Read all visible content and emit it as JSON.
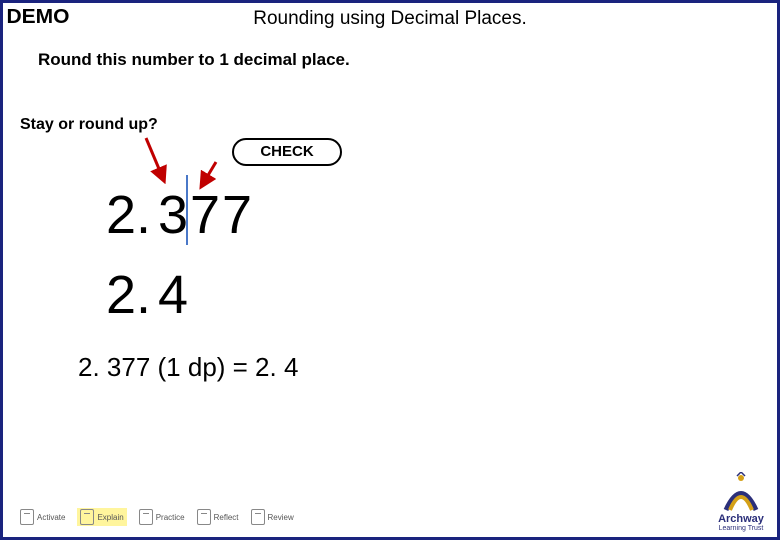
{
  "demo_label": "DEMO",
  "title": "Rounding using Decimal Places.",
  "instruction": "Round this number to 1 decimal place.",
  "hint": "Stay or round up?",
  "check_label": "CHECK",
  "number": {
    "whole": "2",
    "dot": ".",
    "d1": "3",
    "d2": "7",
    "d3": "7"
  },
  "rounded": {
    "whole": "2",
    "dot": ".",
    "d1": "4"
  },
  "final_statement": "2. 377 (1 dp) = 2. 4",
  "footer_steps": [
    "Activate",
    "Explain",
    "Practice",
    "Reflect",
    "Review"
  ],
  "logo": {
    "name": "Archway",
    "sub": "Learning Trust"
  }
}
